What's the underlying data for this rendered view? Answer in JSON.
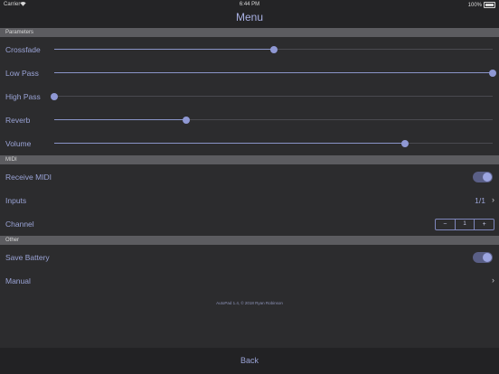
{
  "status": {
    "carrier": "Carrier",
    "wifi_icon": "wifi-icon",
    "time": "6:44 PM",
    "battery": "100%"
  },
  "nav": {
    "title": "Menu"
  },
  "sections": {
    "parameters": "Parameters",
    "midi": "MIDI",
    "other": "Other"
  },
  "parameters": [
    {
      "label": "Crossfade",
      "value": 0.5
    },
    {
      "label": "Low Pass",
      "value": 1.0
    },
    {
      "label": "High Pass",
      "value": 0.0
    },
    {
      "label": "Reverb",
      "value": 0.3
    },
    {
      "label": "Volume",
      "value": 0.8
    }
  ],
  "midi": {
    "receive_label": "Receive MIDI",
    "receive_on": true,
    "inputs_label": "Inputs",
    "inputs_value": "1/1",
    "channel_label": "Channel",
    "channel_minus": "−",
    "channel_value": "1",
    "channel_plus": "+"
  },
  "other": {
    "save_battery_label": "Save Battery",
    "save_battery_on": true,
    "manual_label": "Manual"
  },
  "footer": "AutoPad 1.4, © 2018 Ryan Robinson",
  "bottom": {
    "back_label": "Back"
  },
  "colors": {
    "accent": "#8f98d4",
    "background": "#2c2c2e",
    "section": "#5c5c60"
  }
}
